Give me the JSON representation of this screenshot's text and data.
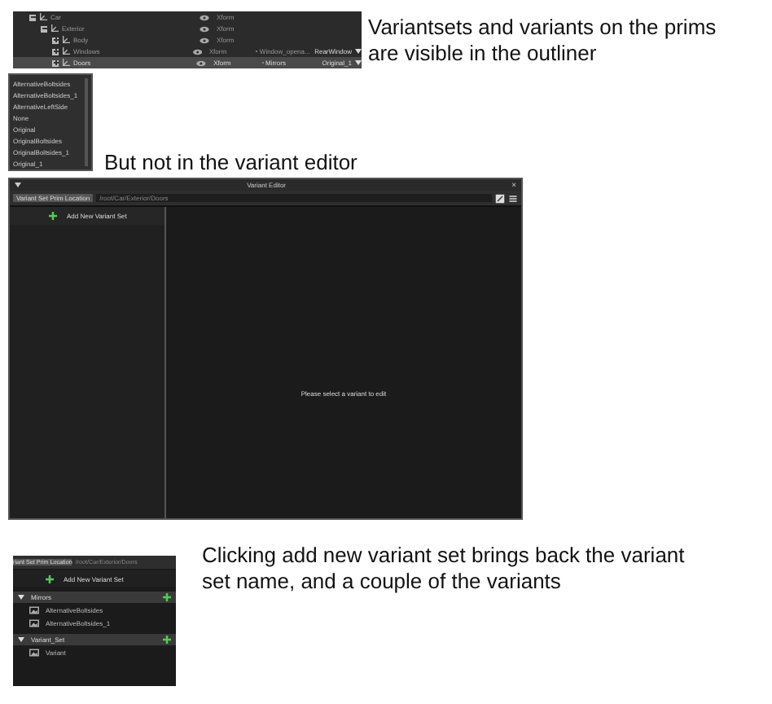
{
  "outliner": {
    "rows": [
      {
        "name": "Car",
        "type": "Xform",
        "expanded": true,
        "selected": false,
        "children": [
          {
            "name": "Exterior",
            "type": "Xform",
            "expanded": true,
            "selected": false,
            "children": [
              {
                "name": "Body",
                "type": "Xform",
                "expanded": false,
                "selected": false
              },
              {
                "name": "Windows",
                "type": "Xform",
                "expanded": false,
                "selected": false,
                "variant_set": "Window_opena...",
                "variant": "RearWindow"
              },
              {
                "name": "Doors",
                "type": "Xform",
                "expanded": false,
                "selected": true,
                "variant_set": "Mirrors",
                "variant": "Original_1"
              }
            ]
          }
        ]
      }
    ]
  },
  "caption_1": "Variantsets and variants on the prims are visible in the outliner",
  "variant_list": [
    "AlternativeBoltsides",
    "AlternativeBoltsides_1",
    "AlternativeLeftSide",
    "None",
    "Original",
    "OriginalBoltsides",
    "OriginalBoltsides_1",
    "Original_1"
  ],
  "caption_2": "But not in the variant editor",
  "variant_editor": {
    "title": "Variant Editor",
    "close": "×",
    "location_label": "Variant Set Prim Location",
    "location": "/root/Car/Exterior/Doors",
    "add_button": "Add New Variant Set",
    "message": "Please select a variant to edit"
  },
  "variant_editor_after": {
    "location_label": "riant Set Prim Location",
    "location": "/root/Car/Exterior/Doors",
    "add_button": "Add New Variant Set",
    "variant_sets": [
      {
        "name": "Mirrors",
        "expanded": true,
        "variants": [
          "AlternativeBoltsides",
          "AlternativeBoltsides_1"
        ]
      },
      {
        "name": "Variant_Set",
        "expanded": true,
        "variants": [
          "Variant"
        ]
      }
    ]
  },
  "caption_3": "Clicking add new variant set brings back the variant set name, and a couple of the variants"
}
